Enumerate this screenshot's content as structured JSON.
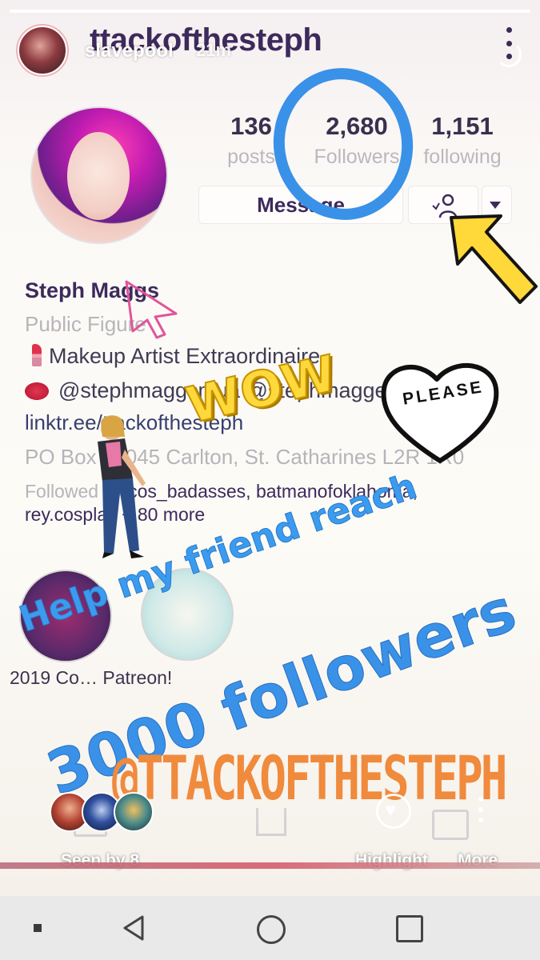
{
  "story": {
    "username": "slavepool",
    "time_ago": "21m",
    "progress": 1.0
  },
  "profile": {
    "username": "ttackofthesteph",
    "stats": [
      {
        "value": "136",
        "label": "posts"
      },
      {
        "value": "2,680",
        "label": "Followers"
      },
      {
        "value": "1,151",
        "label": "following"
      }
    ],
    "message_label": "Message",
    "name": "Steph Maggs",
    "category": "Public Figure",
    "bio_line_1": "Makeup Artist Extraordinaire",
    "bio_line_2": "@stephmaggsmua @stephmagge…",
    "link": "linktr.ee/ttackofthesteph",
    "address": "PO Box 29045 Carlton, St. Catharines L2R 1R0",
    "followed_by_prefix": "Followed by",
    "followed_by_names": "cos_badasses, batmanofoklahoma,",
    "followed_by_more": "rey.cosplay + 80 more",
    "highlight_label": "2019 Co…  Patreon!"
  },
  "stickers": {
    "wow": "WOW",
    "please": "PLEASE",
    "help_text": "Help my friend reach",
    "goal_text": "3000 followers",
    "handle_text": "@TTACKOFTHESTEPH"
  },
  "footer": {
    "seen_by": "Seen by 8",
    "highlight": "Highlight",
    "more": "More"
  },
  "colors": {
    "accent_blue": "#3a91e8",
    "sticker_orange": "#f08a3c",
    "sticker_yellow": "#ffd93b",
    "ig_purple": "#3d2a5c"
  },
  "icons": [
    "more-vertical-icon",
    "person-icon",
    "caret-down-icon",
    "heart-icon",
    "back-icon",
    "home-icon",
    "recents-icon"
  ]
}
